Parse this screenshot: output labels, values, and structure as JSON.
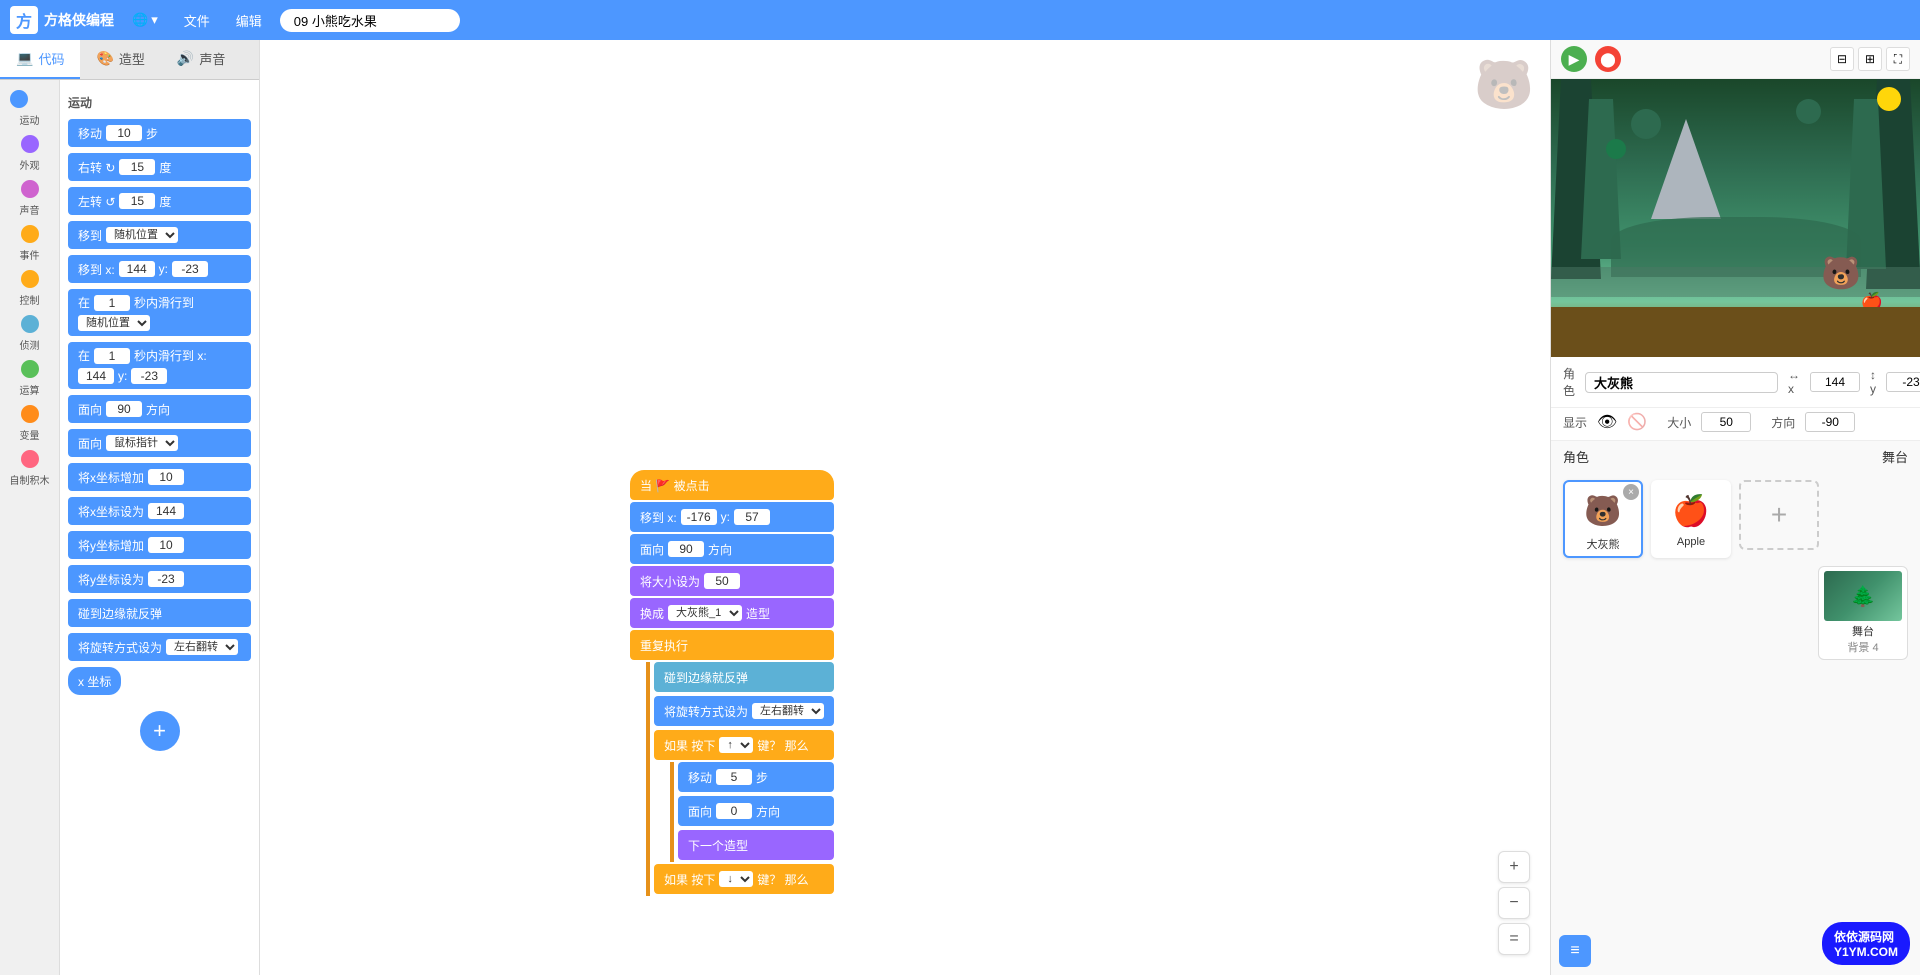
{
  "topbar": {
    "logo_text": "方格侠编程",
    "globe_icon": "🌐",
    "file_menu": "文件",
    "edit_menu": "编辑",
    "project_name": "09 小熊吃水果"
  },
  "tabs": [
    {
      "id": "code",
      "label": "代码",
      "icon": "💻",
      "active": true
    },
    {
      "id": "costume",
      "label": "造型",
      "icon": "🎨",
      "active": false
    },
    {
      "id": "sound",
      "label": "声音",
      "icon": "🔊",
      "active": false
    }
  ],
  "categories": [
    {
      "id": "motion",
      "label": "运动",
      "color": "#4c97ff"
    },
    {
      "id": "looks",
      "label": "外观",
      "color": "#9966ff"
    },
    {
      "id": "sound",
      "label": "声音",
      "color": "#cf63cf"
    },
    {
      "id": "events",
      "label": "事件",
      "color": "#ffab19"
    },
    {
      "id": "control",
      "label": "控制",
      "color": "#ffab19"
    },
    {
      "id": "sensing",
      "label": "侦测",
      "color": "#5cb1d6"
    },
    {
      "id": "operators",
      "label": "运算",
      "color": "#59c059"
    },
    {
      "id": "variables",
      "label": "变量",
      "color": "#ff8c1a"
    },
    {
      "id": "custom",
      "label": "自制积木",
      "color": "#ff6680"
    }
  ],
  "blocks": {
    "header": "运动",
    "items": [
      {
        "type": "motion",
        "text": "移动",
        "val1": "10",
        "suffix": "步"
      },
      {
        "type": "motion",
        "text": "右转 ↻",
        "val1": "15",
        "suffix": "度"
      },
      {
        "type": "motion",
        "text": "左转 ↺",
        "val1": "15",
        "suffix": "度"
      },
      {
        "type": "motion",
        "text": "移到 随机位置▼"
      },
      {
        "type": "motion",
        "text": "移到 x:",
        "val1": "144",
        "mid": "y:",
        "val2": "-23"
      },
      {
        "type": "motion",
        "text": "在",
        "val1": "1",
        "mid": "秒内滑行到 随机位置▼"
      },
      {
        "type": "motion",
        "text": "在",
        "val1": "1",
        "mid": "秒内滑行到 x:",
        "val2": "144",
        "suffix": "y:",
        "val3": "-23"
      },
      {
        "type": "motion",
        "text": "面向",
        "val1": "90",
        "suffix": "方向"
      },
      {
        "type": "motion",
        "text": "面向 鼠标指针▼"
      },
      {
        "type": "motion",
        "text": "将x坐标增加",
        "val1": "10"
      },
      {
        "type": "motion",
        "text": "将x坐标设为",
        "val1": "144"
      },
      {
        "type": "motion",
        "text": "将y坐标增加",
        "val1": "10"
      },
      {
        "type": "motion",
        "text": "将y坐标设为",
        "val1": "-23"
      },
      {
        "type": "motion",
        "text": "碰到边缘就反弹"
      },
      {
        "type": "motion",
        "text": "将旋转方式设为 左右翻转▼"
      },
      {
        "type": "motion",
        "text": "x 坐标",
        "is_reporter": true
      }
    ]
  },
  "canvas": {
    "script": {
      "hat": "当 🚩 被点击",
      "blocks": [
        {
          "type": "motion",
          "text": "移到 x:",
          "v1": "-176",
          "mid": "y:",
          "v2": "57"
        },
        {
          "type": "motion",
          "text": "面向",
          "v1": "90",
          "suffix": "方向"
        },
        {
          "type": "looks",
          "text": "将大小设为",
          "v1": "50"
        },
        {
          "type": "looks",
          "text": "换成 大灰熊_1▼ 造型"
        },
        {
          "type": "control",
          "text": "重复执行"
        },
        {
          "type": "sensing",
          "text": "碰到边缘就反弹",
          "indent": true
        },
        {
          "type": "motion",
          "text": "将旋转方式设为 左右翻转▼",
          "indent": true
        },
        {
          "type": "control",
          "text": "如果 按下 ↑▼ 键？ 那么",
          "indent": true
        },
        {
          "type": "motion",
          "text": "移动",
          "v1": "5",
          "suffix": "步",
          "indent2": true
        },
        {
          "type": "motion",
          "text": "面向",
          "v1": "0",
          "suffix": "方向",
          "indent2": true
        },
        {
          "type": "looks",
          "text": "下一个造型",
          "indent2": true
        },
        {
          "type": "control",
          "text": "如果 按下 ↓▼ 键？ 那么",
          "indent": true
        }
      ]
    }
  },
  "stage": {
    "sprite_name": "大灰熊",
    "x": "144",
    "y": "-23",
    "show": true,
    "size": "50",
    "direction": "-90",
    "sprites": [
      {
        "id": "bear",
        "name": "大灰熊",
        "icon": "🐻",
        "selected": true
      },
      {
        "id": "apple",
        "name": "Apple",
        "icon": "🍎",
        "selected": false
      }
    ],
    "stage_section": {
      "label": "舞台",
      "bg_count": "4"
    },
    "controls": {
      "green_flag": "▶",
      "stop": "⬤"
    }
  },
  "zoom": {
    "in": "+",
    "out": "−",
    "reset": "="
  }
}
